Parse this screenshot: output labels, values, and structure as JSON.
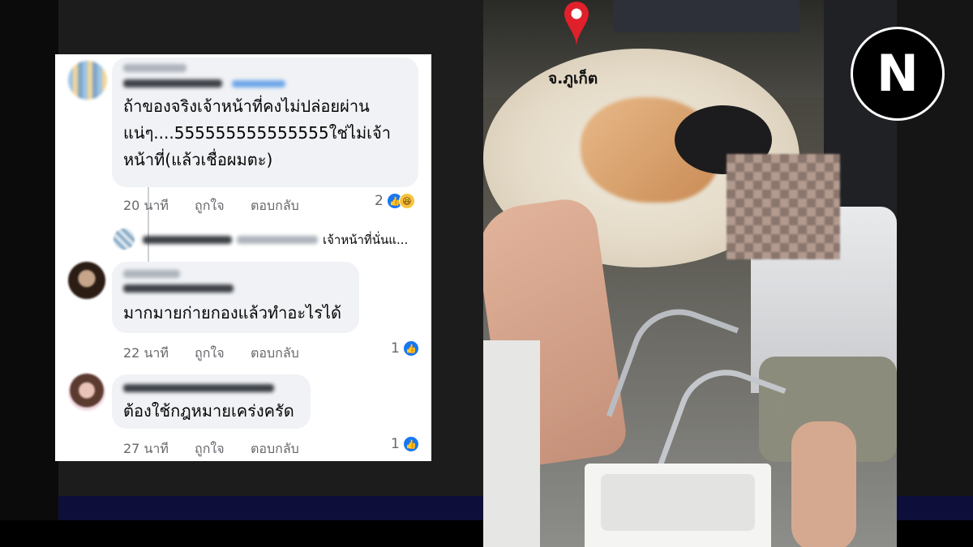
{
  "comments": [
    {
      "text_lines": [
        "ถ้าของจริงเจ้าหน้าที่คงไม่ปล่อยผ่าน",
        "แน่ๆ....555555555555555ใช่ไม่เจ้า",
        "หน้าที่(แล้วเชื่อผมตะ)"
      ],
      "time": "20 นาที",
      "like": "ถูกใจ",
      "reply": "ตอบกลับ",
      "reaction_count": "2",
      "reaction_icons": [
        "like-icon",
        "haha-icon"
      ]
    },
    {
      "text_lines": [
        "มากมายก่ายกองแล้วทำอะไรได้"
      ],
      "time": "22 นาที",
      "like": "ถูกใจ",
      "reply": "ตอบกลับ",
      "reaction_count": "1",
      "reaction_icons": [
        "like-icon"
      ]
    },
    {
      "text_lines": [
        "ต้องใช้กฎหมายเคร่งครัด"
      ],
      "time": "27 นาที",
      "like": "ถูกใจ",
      "reply": "ตอบกลับ",
      "reaction_count": "1",
      "reaction_icons": [
        "like-icon"
      ]
    }
  ],
  "reply_preview": "เจ้าหน้าที่นั่นแ...",
  "video": {
    "location_label": "จ.ภูเก็ต",
    "pin_icon": "map-pin-icon"
  },
  "logo": {
    "letter": "N"
  },
  "colors": {
    "bubble": "#f0f2f5",
    "meta_text": "#65676b",
    "like_blue": "#1877f2",
    "pin_red": "#e0202a",
    "navy_strip": "#0d0f3a"
  }
}
